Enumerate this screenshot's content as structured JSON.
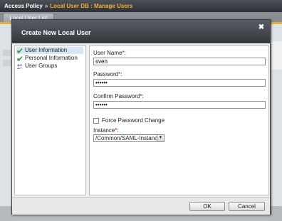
{
  "app": {
    "breadcrumb": {
      "root": "Access Policy",
      "separator": "»",
      "current": "Local User DB : Manage Users"
    },
    "tab": "Local User List"
  },
  "dialog": {
    "title": "Create New Local User",
    "close_glyph": "✖",
    "nav": [
      {
        "label": "User Information",
        "icon": "check-icon",
        "selected": true
      },
      {
        "label": "Personal Information",
        "icon": "check-icon",
        "selected": false
      },
      {
        "label": "User Groups",
        "icon": "user-groups-icon",
        "selected": false
      }
    ],
    "form": {
      "username_label": "User Name",
      "username_value": "sven",
      "password_label": "Password",
      "password_value": "••••••",
      "confirm_label": "Confirm Password",
      "confirm_value": "••••••",
      "force_change_label": "Force Password Change",
      "force_change_checked": false,
      "instance_label": "Instance",
      "instance_value": "/Common/SAML-Instance",
      "required_mark": "*",
      "label_suffix": ":"
    },
    "buttons": {
      "ok": "OK",
      "cancel": "Cancel"
    }
  },
  "colors": {
    "header_dark": "#33363b",
    "breadcrumb_accent": "#f0b23b",
    "accent_stripe": "#e2b03b",
    "nav_selected": "#d8e6f4",
    "check_green": "#3a9a2a",
    "required_red": "#cc0000"
  }
}
